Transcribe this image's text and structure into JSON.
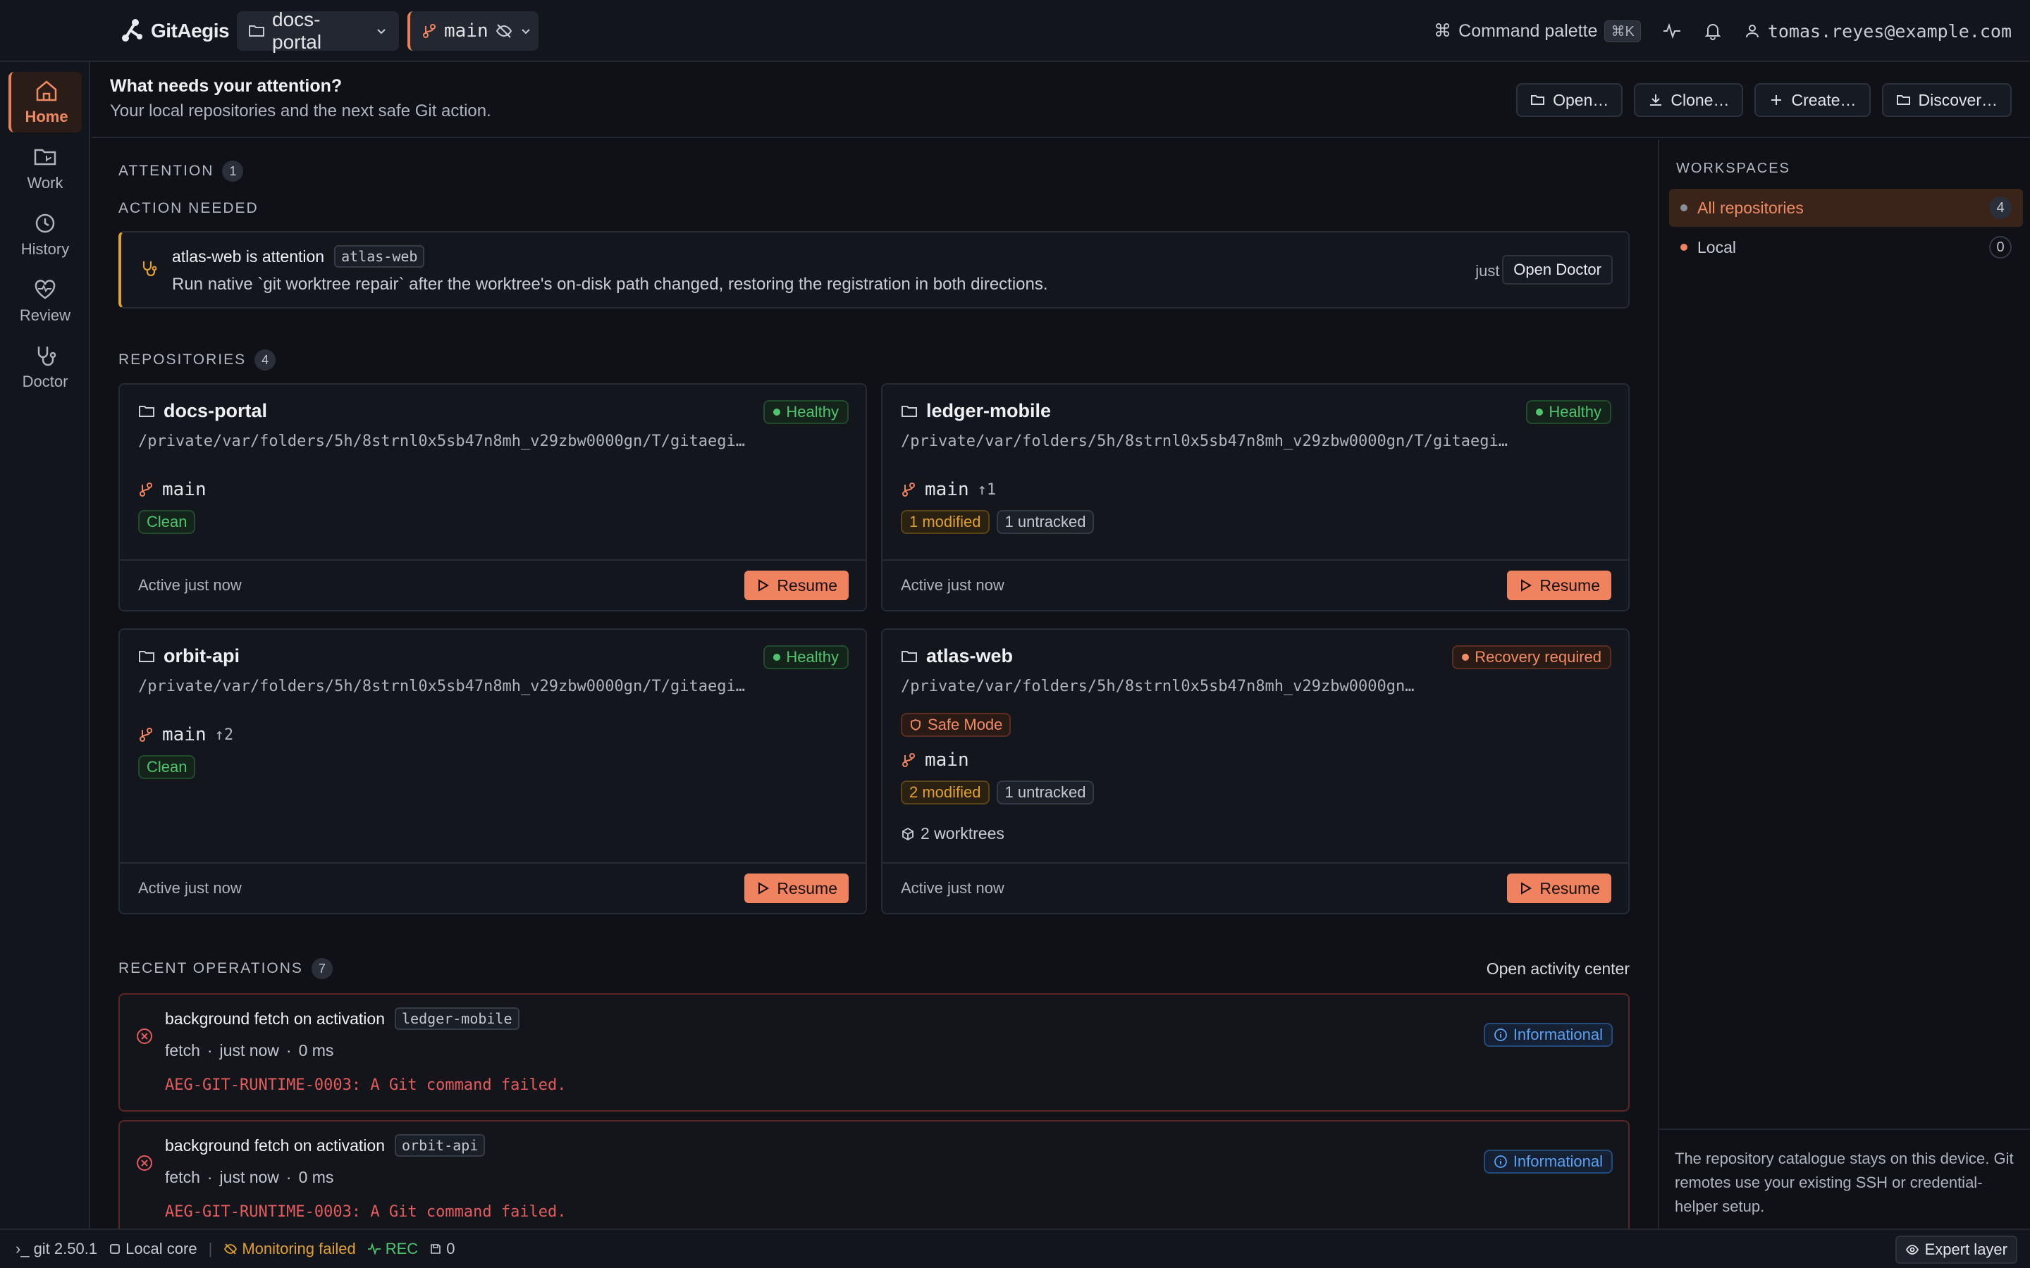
{
  "topbar": {
    "brand": "GitAegis",
    "repo_selector": "docs-portal",
    "branch_selector": "main",
    "command_palette_label": "Command palette",
    "command_palette_shortcut": "⌘K",
    "user_email": "tomas.reyes@example.com"
  },
  "rail": {
    "items": [
      {
        "label": "Home",
        "icon": "home-icon"
      },
      {
        "label": "Work",
        "icon": "folder-branch-icon"
      },
      {
        "label": "History",
        "icon": "history-icon"
      },
      {
        "label": "Review",
        "icon": "heart-pulse-icon"
      },
      {
        "label": "Doctor",
        "icon": "stethoscope-icon"
      }
    ]
  },
  "header": {
    "title": "What needs your attention?",
    "subtitle": "Your local repositories and the next safe Git action.",
    "actions": {
      "open": "Open…",
      "clone": "Clone…",
      "create": "Create…",
      "discover": "Discover…"
    }
  },
  "attention": {
    "label": "ATTENTION",
    "count": "1",
    "action_needed_label": "ACTION NEEDED",
    "item": {
      "title": "atlas-web is attention",
      "tag": "atlas-web",
      "description": "Run native `git worktree repair` after the worktree's on-disk path changed, restoring the registration in both directions.",
      "time": "just now",
      "button": "Open Doctor"
    }
  },
  "repositories": {
    "label": "REPOSITORIES",
    "count": "4",
    "items": [
      {
        "name": "docs-portal",
        "health": "Healthy",
        "path": "/private/var/folders/5h/8strnl0x5sb47n8mh_v29zbw0000gn/T/gitaegis-demo/docs-portal",
        "branch": "main",
        "ahead": "",
        "chips": [
          "Clean"
        ],
        "active": "Active just now",
        "resume": "Resume"
      },
      {
        "name": "ledger-mobile",
        "health": "Healthy",
        "path": "/private/var/folders/5h/8strnl0x5sb47n8mh_v29zbw0000gn/T/gitaegis-demo/ledger-mobile",
        "branch": "main",
        "ahead": "↑1",
        "chips": [
          "1 modified",
          "1 untracked"
        ],
        "active": "Active just now",
        "resume": "Resume"
      },
      {
        "name": "orbit-api",
        "health": "Healthy",
        "path": "/private/var/folders/5h/8strnl0x5sb47n8mh_v29zbw0000gn/T/gitaegis-demo/orbit-api",
        "branch": "main",
        "ahead": "↑2",
        "chips": [
          "Clean"
        ],
        "active": "Active just now",
        "resume": "Resume"
      },
      {
        "name": "atlas-web",
        "health": "Recovery required",
        "path": "/private/var/folders/5h/8strnl0x5sb47n8mh_v29zbw0000gn/T/gitaegis-demo/atlas-web",
        "safe_mode": "Safe Mode",
        "branch": "main",
        "ahead": "",
        "chips": [
          "2 modified",
          "1 untracked"
        ],
        "worktrees": "2 worktrees",
        "active": "Active just now",
        "resume": "Resume"
      }
    ]
  },
  "operations": {
    "label": "RECENT OPERATIONS",
    "count": "7",
    "activity_link": "Open activity center",
    "items": [
      {
        "title": "background fetch on activation",
        "tag": "ledger-mobile",
        "kind": "fetch",
        "time": "just now",
        "duration": "0 ms",
        "error": "AEG-GIT-RUNTIME-0003: A Git command failed.",
        "badge": "Informational"
      },
      {
        "title": "background fetch on activation",
        "tag": "orbit-api",
        "kind": "fetch",
        "time": "just now",
        "duration": "0 ms",
        "error": "AEG-GIT-RUNTIME-0003: A Git command failed.",
        "badge": "Informational"
      }
    ]
  },
  "workspaces": {
    "label": "WORKSPACES",
    "items": [
      {
        "label": "All repositories",
        "count": "4"
      },
      {
        "label": "Local",
        "count": "0"
      }
    ],
    "footer": "The repository catalogue stays on this device. Git remotes use your existing SSH or credential-helper setup."
  },
  "statusbar": {
    "git_version": "git 2.50.1",
    "core": "Local core",
    "monitoring": "Monitoring failed",
    "rec": "REC",
    "queue": "0",
    "expert": "Expert layer"
  },
  "colors": {
    "accent": "#ef8360",
    "healthy": "#4fc46e",
    "warning": "#e0a030",
    "error": "#e25c5c",
    "info": "#5aa0f0"
  }
}
